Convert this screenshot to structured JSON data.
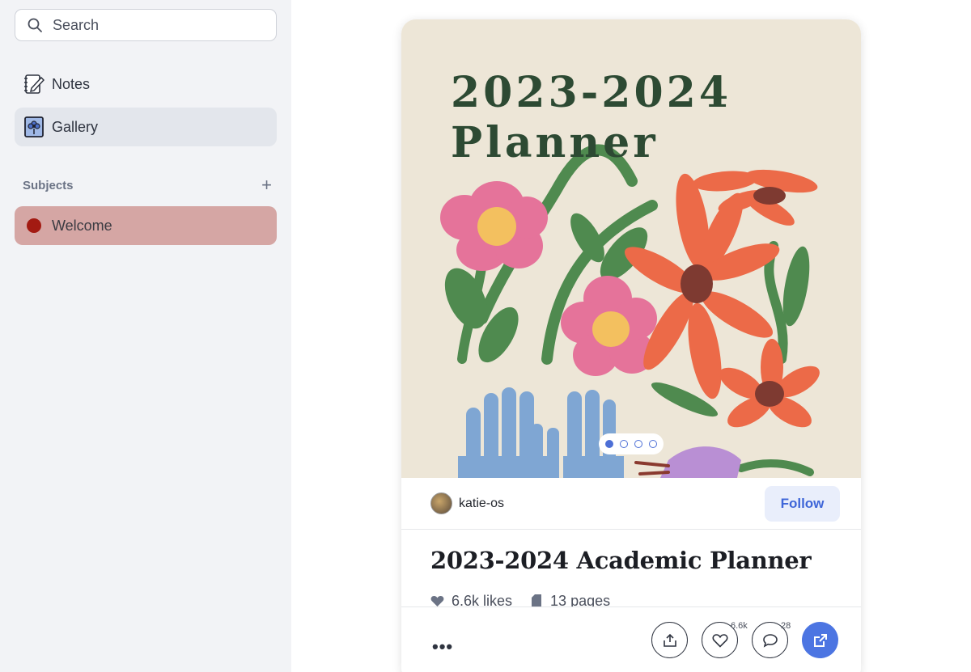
{
  "sidebar": {
    "search": {
      "placeholder": "Search"
    },
    "nav": [
      {
        "label": "Notes",
        "icon": "notebook-pen-icon"
      },
      {
        "label": "Gallery",
        "icon": "gallery-flower-icon",
        "selected": true
      }
    ],
    "subjects": {
      "heading": "Subjects",
      "add_icon": "plus-icon",
      "items": [
        {
          "label": "Welcome",
          "color": "#a31a12",
          "highlight": "#d5a6a4"
        }
      ]
    }
  },
  "card": {
    "cover": {
      "title_line1": "2023-2024",
      "title_line2": "Planner",
      "background": "#ede6d7",
      "pager": {
        "count": 4,
        "active": 1
      }
    },
    "author": {
      "name": "katie-os"
    },
    "follow_label": "Follow",
    "title": "2023-2024 Academic Planner",
    "stats": {
      "likes": "6.6k likes",
      "pages": "13 pages"
    },
    "actions": {
      "more_icon": "ellipsis-icon",
      "share_icon": "share-icon",
      "like_icon": "heart-icon",
      "like_count": "6.6k",
      "comment_icon": "comment-icon",
      "comment_count": "28",
      "open_icon": "open-external-icon",
      "accent": "#4c75e2"
    }
  }
}
